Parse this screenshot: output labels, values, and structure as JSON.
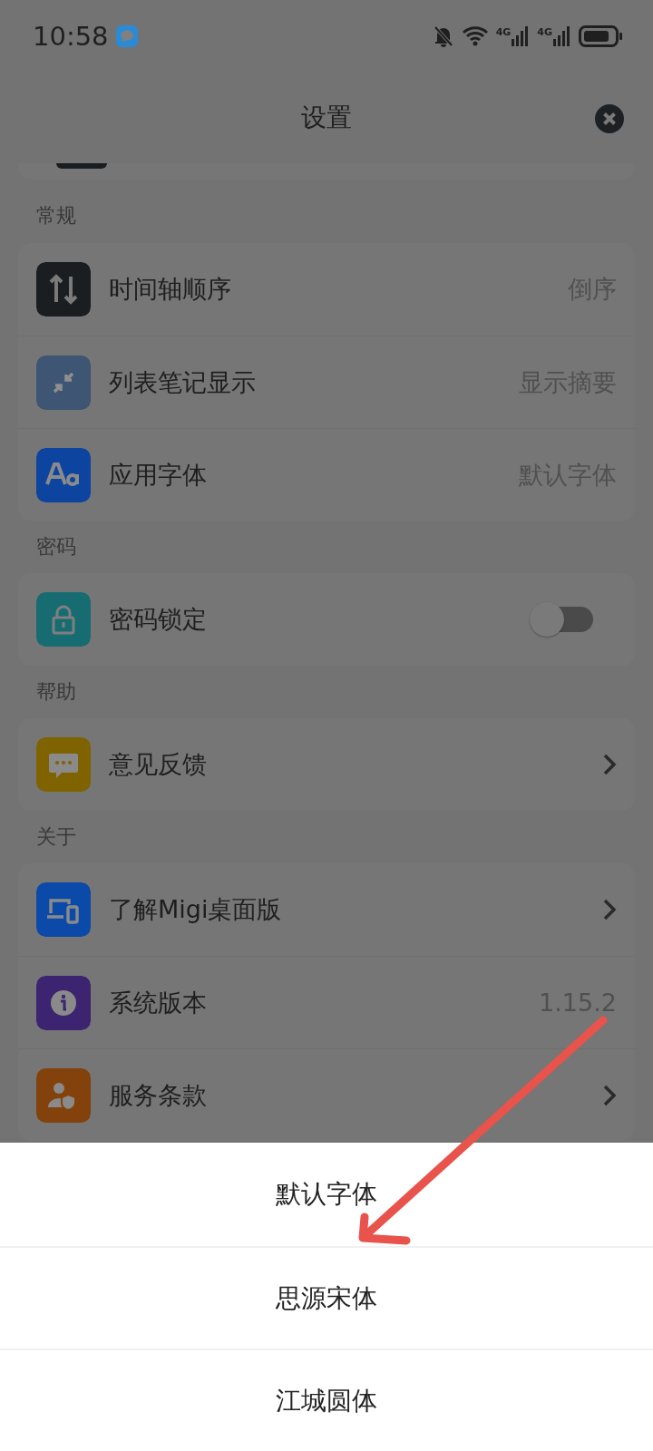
{
  "status_bar": {
    "time": "10:58",
    "network_labels": [
      "4G",
      "4G"
    ]
  },
  "header": {
    "title": "设置"
  },
  "sections": [
    {
      "title": "常规",
      "items": [
        {
          "label": "时间轴顺序",
          "kind": "value",
          "value": "倒序"
        },
        {
          "label": "列表笔记显示",
          "kind": "value",
          "value": "显示摘要"
        },
        {
          "label": "应用字体",
          "kind": "value",
          "value": "默认字体"
        }
      ]
    },
    {
      "title": "密码",
      "items": [
        {
          "label": "密码锁定",
          "kind": "switch",
          "on": false
        }
      ]
    },
    {
      "title": "帮助",
      "items": [
        {
          "label": "意见反馈",
          "kind": "link"
        }
      ]
    },
    {
      "title": "关于",
      "items": [
        {
          "label": "了解Migi桌面版",
          "kind": "link"
        },
        {
          "label": "系统版本",
          "kind": "value",
          "value": "1.15.2"
        },
        {
          "label": "服务条款",
          "kind": "link"
        }
      ]
    }
  ],
  "font_sheet": {
    "options": [
      "默认字体",
      "思源宋体",
      "江城圆体"
    ]
  }
}
